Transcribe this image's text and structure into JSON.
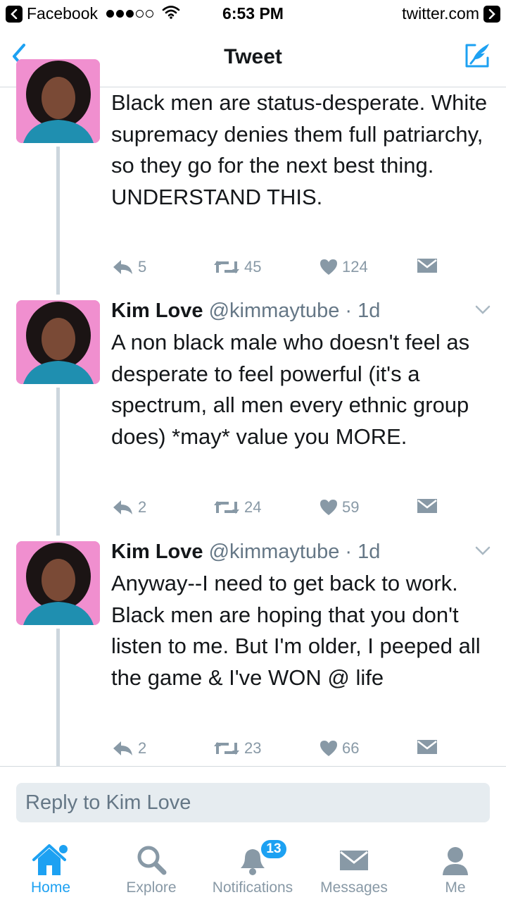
{
  "status_bar": {
    "back_app": "Facebook",
    "time": "6:53 PM",
    "url": "twitter.com"
  },
  "nav": {
    "title": "Tweet"
  },
  "tweets": [
    {
      "name": "",
      "handle": "",
      "time": "",
      "text": "Black men are status-desperate. White supremacy denies them full patriarchy, so they go for the next best thing. UNDERSTAND THIS.",
      "replies": "5",
      "retweets": "45",
      "likes": "124"
    },
    {
      "name": "Kim Love",
      "handle": "@kimmaytube",
      "time": "1d",
      "text": "A non black male who doesn't feel as desperate to feel powerful (it's a spectrum, all men every ethnic group does) *may* value you MORE.",
      "replies": "2",
      "retweets": "24",
      "likes": "59"
    },
    {
      "name": "Kim Love",
      "handle": "@kimmaytube",
      "time": "1d",
      "text": "Anyway--I need to get back to work. Black men are hoping that you don't listen to me. But I'm older, I peeped all the game & I've WON @ life",
      "replies": "2",
      "retweets": "23",
      "likes": "66"
    }
  ],
  "reply": {
    "placeholder": "Reply to Kim Love"
  },
  "tabs": [
    {
      "label": "Home",
      "icon": "home-icon",
      "active": true
    },
    {
      "label": "Explore",
      "icon": "search-icon",
      "active": false
    },
    {
      "label": "Notifications",
      "icon": "bell-icon",
      "active": false,
      "badge": "13"
    },
    {
      "label": "Messages",
      "icon": "envelope-icon",
      "active": false
    },
    {
      "label": "Me",
      "icon": "person-icon",
      "active": false
    }
  ],
  "colors": {
    "accent": "#1da1f2",
    "icon_gray": "#8899a6",
    "thread_line": "#ccd6dd",
    "avatar_bg": "#f08fcf"
  }
}
